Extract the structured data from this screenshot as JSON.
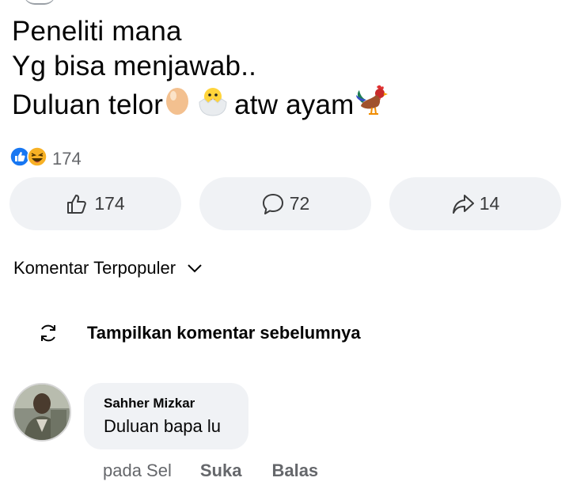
{
  "post": {
    "line1": "Peneliti mana",
    "line2": "Yg bisa menjawab..",
    "line3_a": "Duluan telor",
    "line3_b": "atw ayam",
    "emojis": [
      "egg-emoji",
      "hatching-chick-emoji",
      "rooster-emoji"
    ]
  },
  "reactions": {
    "icons": [
      "like-icon",
      "haha-icon"
    ],
    "count": "174"
  },
  "actions": {
    "like_count": "174",
    "comment_count": "72",
    "share_count": "14"
  },
  "comments_section": {
    "sort_label": "Komentar Terpopuler",
    "previous_label": "Tampilkan komentar sebelumnya"
  },
  "comment": {
    "author": "Sahher Mizkar",
    "text": "Duluan bapa lu",
    "time": "pada Sel",
    "like_label": "Suka",
    "reply_label": "Balas"
  },
  "colors": {
    "accent_blue": "#1877f2",
    "pill_bg": "#f0f2f5",
    "secondary_text": "#65676b"
  }
}
